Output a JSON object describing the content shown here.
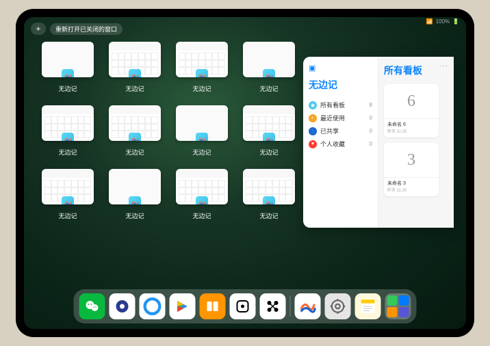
{
  "status": {
    "battery": "100%"
  },
  "top": {
    "add": "+",
    "reopen": "重新打开已关闭的窗口"
  },
  "expose": {
    "app_label": "无边记",
    "windows": [
      {
        "content": false
      },
      {
        "content": true
      },
      {
        "content": true
      },
      {
        "content": false
      },
      {
        "content": true
      },
      {
        "content": true
      },
      {
        "content": false
      },
      {
        "content": true
      },
      {
        "content": true
      },
      {
        "content": false
      },
      {
        "content": true
      },
      {
        "content": true
      }
    ]
  },
  "main_window": {
    "sidebar": {
      "title": "无边记",
      "items": [
        {
          "icon_color": "#4bc8ed",
          "label": "所有看板",
          "count": "8"
        },
        {
          "icon_color": "#f5a623",
          "label": "最近使用",
          "count": "0"
        },
        {
          "icon_color": "#1e62d0",
          "label": "已共享",
          "count": "0"
        },
        {
          "icon_color": "#ff3b30",
          "label": "个人收藏",
          "count": "0"
        }
      ]
    },
    "content": {
      "title": "所有看板",
      "more": "···",
      "boards": [
        {
          "glyph": "6",
          "name": "未命名 6",
          "time": "昨天 11:25"
        },
        {
          "glyph": "3",
          "name": "未命名 3",
          "time": "昨天 11:20"
        }
      ]
    }
  },
  "dock": {
    "apps": [
      {
        "name": "wechat",
        "bg": "#09b83e"
      },
      {
        "name": "quark",
        "bg": "#ffffff"
      },
      {
        "name": "qqbrowser",
        "bg": "#ffffff"
      },
      {
        "name": "play",
        "bg": "#ffffff"
      },
      {
        "name": "books",
        "bg": "#ff9500"
      },
      {
        "name": "dice",
        "bg": "#ffffff"
      },
      {
        "name": "connect",
        "bg": "#ffffff"
      }
    ],
    "recent": [
      {
        "name": "freeform",
        "bg": "#ffffff"
      },
      {
        "name": "settings",
        "bg": "#e5e5e5"
      },
      {
        "name": "notes",
        "bg": "#fff8dc"
      }
    ]
  }
}
